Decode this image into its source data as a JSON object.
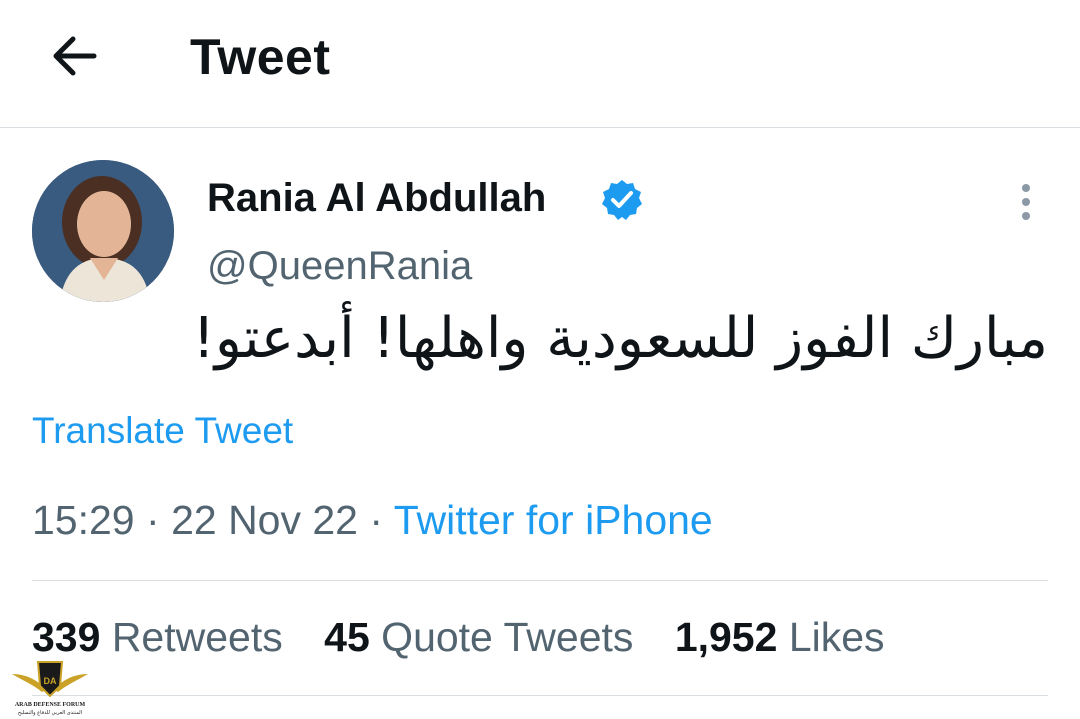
{
  "header": {
    "title": "Tweet",
    "back_icon": "arrow-left-icon"
  },
  "tweet": {
    "author_name": "Rania Al Abdullah",
    "handle": "@QueenRania",
    "verified_icon": "verified-badge-icon",
    "text": "مبارك الفوز للسعودية واهلها! أبدعتو!",
    "translate_label": "Translate Tweet",
    "time": "15:29",
    "date": "22 Nov 22",
    "separator": "·",
    "source": "Twitter for iPhone"
  },
  "stats": {
    "retweets_count": "339",
    "retweets_label": "Retweets",
    "quotes_count": "45",
    "quotes_label": "Quote Tweets",
    "likes_count": "1,952",
    "likes_label": "Likes"
  },
  "watermark": {
    "line1": "ARAB DEFENSE FORUM",
    "line2": "المنتدى العربي للدفاع والتسليح"
  },
  "colors": {
    "accent": "#1d9bf0",
    "secondary_text": "#536471",
    "primary_text": "#0f1419"
  }
}
